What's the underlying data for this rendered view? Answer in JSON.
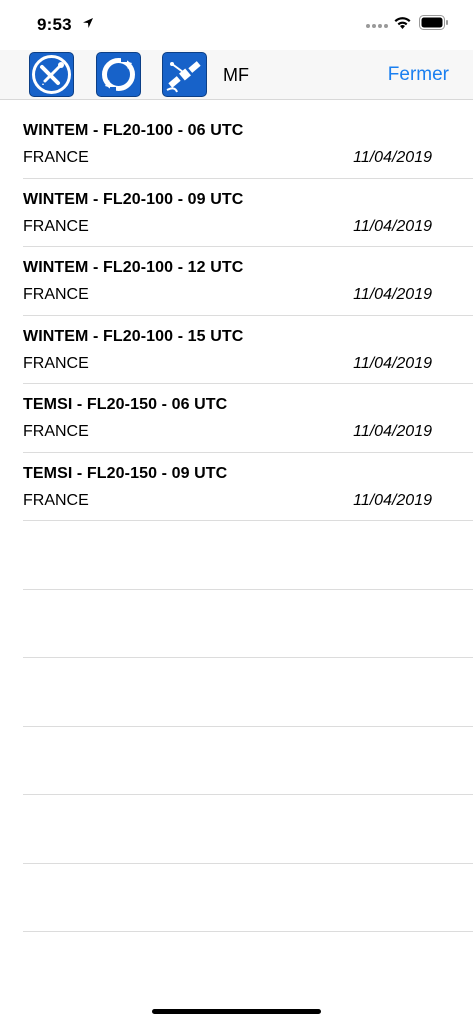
{
  "status_bar": {
    "time": "9:53"
  },
  "toolbar": {
    "label": "MF",
    "close_label": "Fermer",
    "icons": [
      "tools-icon",
      "refresh-icon",
      "satellite-icon"
    ]
  },
  "list": {
    "items": [
      {
        "title": "WINTEM - FL20-100 - 06 UTC",
        "region": "FRANCE",
        "date": "11/04/2019"
      },
      {
        "title": "WINTEM - FL20-100 - 09 UTC",
        "region": "FRANCE",
        "date": "11/04/2019"
      },
      {
        "title": "WINTEM - FL20-100 - 12 UTC",
        "region": "FRANCE",
        "date": "11/04/2019"
      },
      {
        "title": "WINTEM - FL20-100 - 15 UTC",
        "region": "FRANCE",
        "date": "11/04/2019"
      },
      {
        "title": "TEMSI - FL20-150 - 06 UTC",
        "region": "FRANCE",
        "date": "11/04/2019"
      },
      {
        "title": "TEMSI - FL20-150 - 09 UTC",
        "region": "FRANCE",
        "date": "11/04/2019"
      }
    ]
  },
  "colors": {
    "accent": "#1a7ff0",
    "icon_bg": "#1762c9"
  }
}
